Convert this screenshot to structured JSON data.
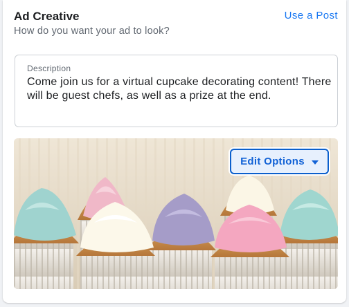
{
  "header": {
    "title": "Ad Creative",
    "subtitle": "How do you want your ad to look?",
    "use_post_link": "Use a Post"
  },
  "description": {
    "label": "Description",
    "value": "Come join us for a virtual cupcake decorating content! There will be guest chefs, as well as a prize at the end."
  },
  "media": {
    "edit_options_label": "Edit Options",
    "edit_options_icon": "caret-down-icon"
  },
  "colors": {
    "accent": "#1877f2",
    "focus_border": "#0b5fcc"
  }
}
